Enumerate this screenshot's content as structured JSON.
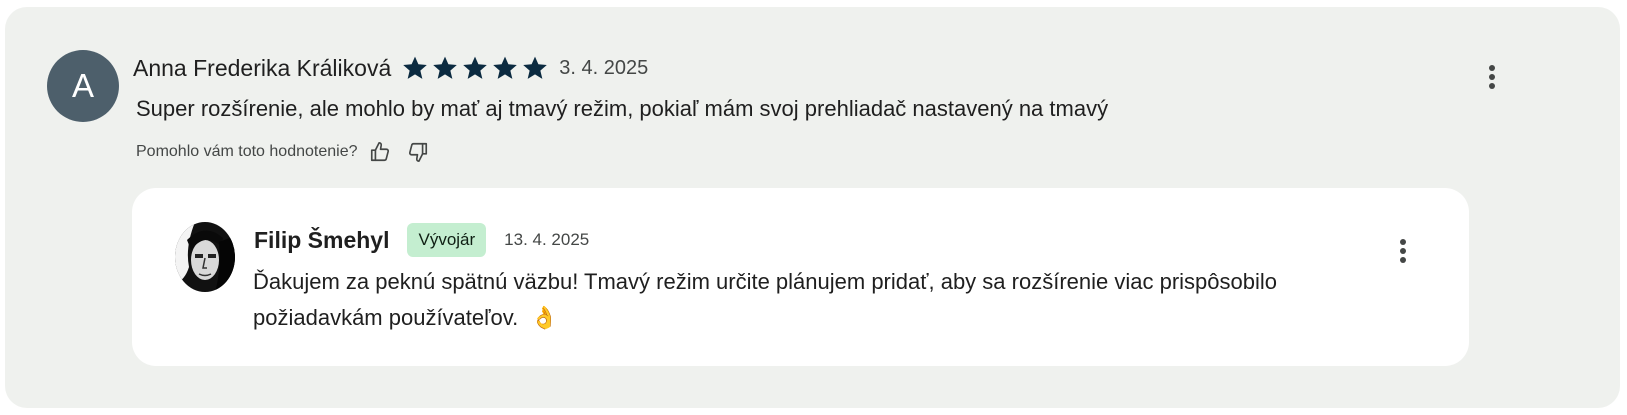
{
  "review": {
    "avatar_initial": "A",
    "author": "Anna Frederika Králiková",
    "rating": 5,
    "rating_max": 5,
    "date": "3. 4. 2025",
    "text": "Super rozšírenie, ale mohlo by mať aj tmavý režim, pokiaľ mám svoj prehliadač nastavený na tmavý",
    "helpful_label": "Pomohlo vám toto hodnotenie?"
  },
  "reply": {
    "author": "Filip Šmehyl",
    "badge": "Vývojár",
    "date": "13. 4. 2025",
    "text": "Ďakujem za peknú spätnú väzbu! Tmavý režim určite plánujem pridať, aby sa rozšírenie viac prispôsobilo požiadavkám používateľov.",
    "emoji": "👌"
  },
  "colors": {
    "card_background": "#eff1ee",
    "avatar_background": "#4d5f6b",
    "star_color": "#0b2a40",
    "badge_background": "#c4eed0",
    "reply_background": "#ffffff"
  },
  "icons": {
    "star": "star-icon",
    "thumbs_up": "thumbs-up-icon",
    "thumbs_down": "thumbs-down-icon",
    "more": "more-vert-icon"
  }
}
